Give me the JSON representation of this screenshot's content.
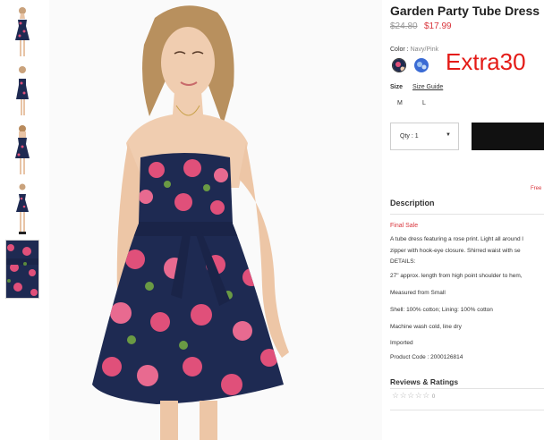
{
  "product": {
    "title": "Garden Party Tube Dress",
    "price_old": "$24.80",
    "price_new": "$17.99"
  },
  "color": {
    "label": "Color",
    "separator": " : ",
    "value": "Navy/Pink",
    "swatch_colors": [
      "#1f2a4d",
      "#3a6bd4"
    ]
  },
  "promo": "Extra30",
  "size": {
    "label": "Size",
    "guide_label": "Size Guide",
    "options": [
      "M",
      "L"
    ]
  },
  "quantity": {
    "label": "Qty : 1"
  },
  "shipping_note": "Free",
  "description": {
    "heading": "Description",
    "final_sale": "Final Sale",
    "lines": [
      "A tube dress featuring a rose print. Light all around l",
      "zipper with hook-eye closure. Shirred waist with se",
      "DETAILS:",
      "27\" approx. length from high point shoulder to hem,",
      "Measured from Small",
      "Shell: 100% cotton; Lining: 100% cotton",
      "Machine wash cold, line dry",
      "Imported",
      "Product Code : 2000126814"
    ]
  },
  "reviews": {
    "heading": "Reviews & Ratings",
    "stars": "☆☆☆☆☆",
    "count": "0"
  },
  "colors": {
    "price_red": "#d9343b",
    "promo_red": "#e41b17",
    "dress_navy": "#1e2a52",
    "rose_pink": "#e0507a",
    "button_black": "#111111"
  }
}
